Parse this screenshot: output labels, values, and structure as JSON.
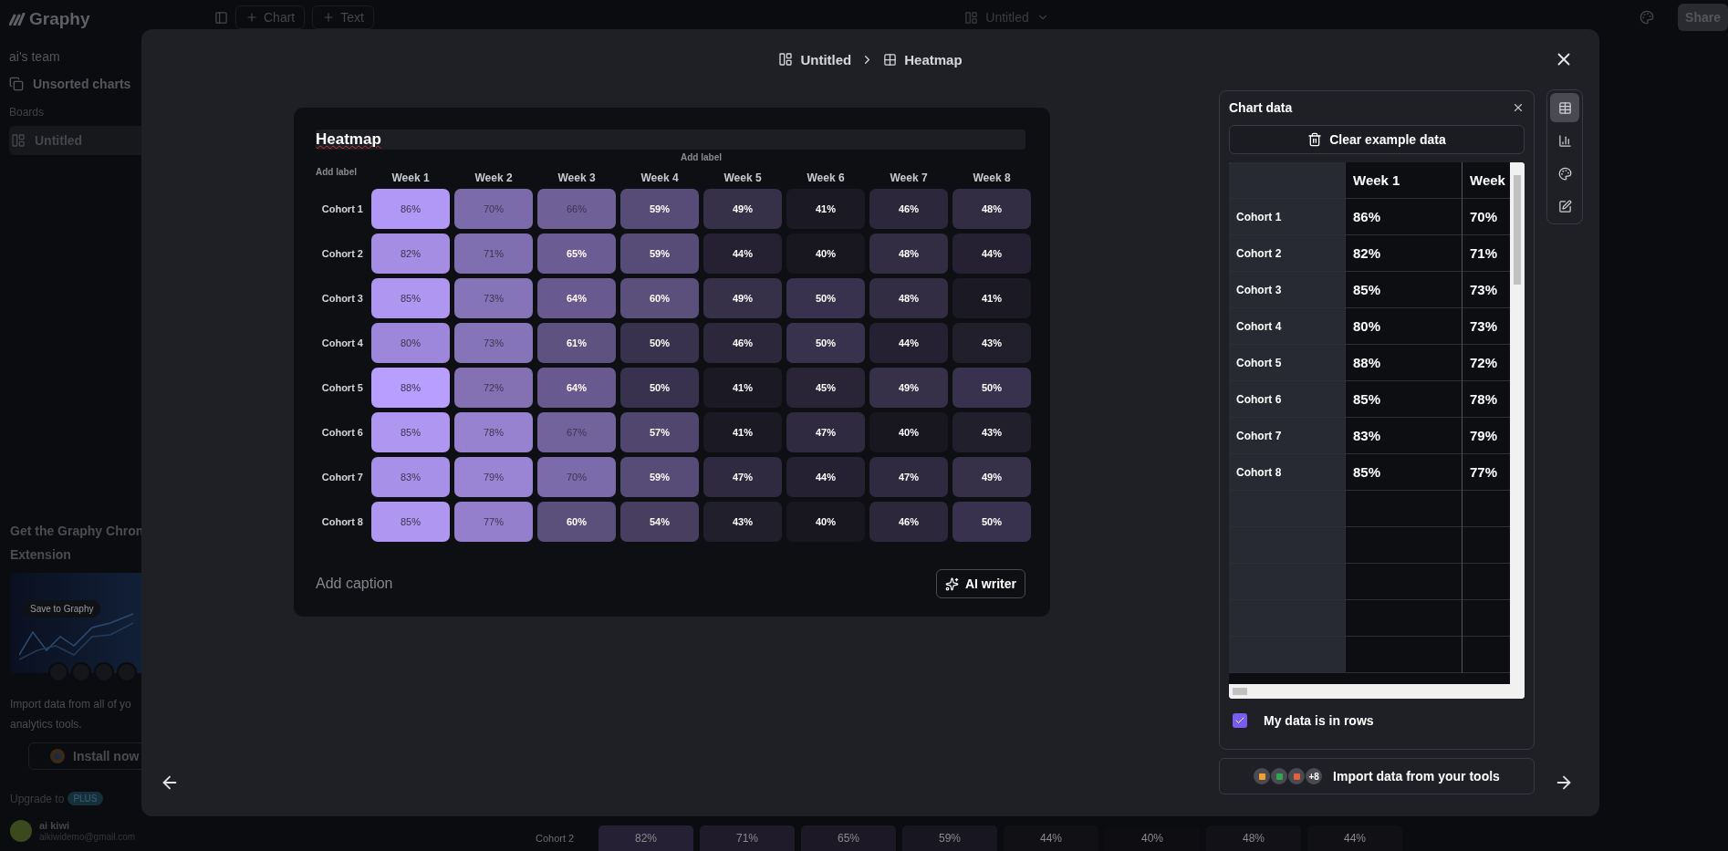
{
  "app": {
    "logo": "Graphy",
    "team": "ai's team",
    "nav": [
      {
        "label": "Unsorted charts"
      }
    ],
    "boards_heading": "Boards",
    "boards": [
      {
        "label": "Untitled",
        "selected": true
      }
    ],
    "promo": {
      "title_lines": [
        "Get the Graphy Chron",
        "Extension"
      ],
      "image_button": "Save to Graphy",
      "text_lines": [
        "Import data from all of yo",
        "analytics tools."
      ],
      "install_button": "Install now"
    },
    "upgrade": {
      "label": "Upgrade to",
      "badge": "PLUS"
    },
    "user": {
      "name": "ai kiwi",
      "email": "aikiwidemo@gmail.com"
    },
    "toolbar": {
      "buttons": [
        "Chart",
        "Text"
      ],
      "board_title": "Untitled",
      "share": "Share"
    },
    "background_row": {
      "label": "Cohort 2",
      "values": [
        "82%",
        "71%",
        "65%",
        "59%",
        "44%",
        "40%",
        "48%",
        "44%"
      ]
    }
  },
  "modal": {
    "breadcrumb": {
      "board": "Untitled",
      "chart": "Heatmap"
    },
    "chart": {
      "title": "Heatmap",
      "x_label_placeholder": "Add label",
      "y_label_placeholder": "Add label",
      "columns": [
        "Week 1",
        "Week 2",
        "Week 3",
        "Week 4",
        "Week 5",
        "Week 6",
        "Week 7",
        "Week 8"
      ],
      "rows": [
        {
          "label": "Cohort 1",
          "values": [
            "86%",
            "70%",
            "66%",
            "59%",
            "49%",
            "41%",
            "46%",
            "48%"
          ]
        },
        {
          "label": "Cohort 2",
          "values": [
            "82%",
            "71%",
            "65%",
            "59%",
            "44%",
            "40%",
            "48%",
            "44%"
          ]
        },
        {
          "label": "Cohort 3",
          "values": [
            "85%",
            "73%",
            "64%",
            "60%",
            "49%",
            "50%",
            "48%",
            "41%"
          ]
        },
        {
          "label": "Cohort 4",
          "values": [
            "80%",
            "73%",
            "61%",
            "50%",
            "46%",
            "50%",
            "44%",
            "43%"
          ]
        },
        {
          "label": "Cohort 5",
          "values": [
            "88%",
            "72%",
            "64%",
            "50%",
            "41%",
            "45%",
            "49%",
            "50%"
          ]
        },
        {
          "label": "Cohort 6",
          "values": [
            "85%",
            "78%",
            "67%",
            "57%",
            "41%",
            "47%",
            "40%",
            "43%"
          ]
        },
        {
          "label": "Cohort 7",
          "values": [
            "83%",
            "79%",
            "70%",
            "59%",
            "47%",
            "44%",
            "47%",
            "49%"
          ]
        },
        {
          "label": "Cohort 8",
          "values": [
            "85%",
            "77%",
            "60%",
            "54%",
            "43%",
            "40%",
            "46%",
            "50%"
          ]
        }
      ],
      "caption_placeholder": "Add caption",
      "ai_button": "AI writer"
    },
    "data_panel": {
      "title": "Chart data",
      "clear_button": "Clear example data",
      "columns": [
        "Week 1",
        "Week"
      ],
      "rows": [
        {
          "label": "Cohort 1",
          "values": [
            "86%",
            "70%"
          ]
        },
        {
          "label": "Cohort 2",
          "values": [
            "82%",
            "71%"
          ]
        },
        {
          "label": "Cohort 3",
          "values": [
            "85%",
            "73%"
          ]
        },
        {
          "label": "Cohort 4",
          "values": [
            "80%",
            "73%"
          ]
        },
        {
          "label": "Cohort 5",
          "values": [
            "88%",
            "72%"
          ]
        },
        {
          "label": "Cohort 6",
          "values": [
            "85%",
            "78%"
          ]
        },
        {
          "label": "Cohort 7",
          "values": [
            "83%",
            "79%"
          ]
        },
        {
          "label": "Cohort 8",
          "values": [
            "85%",
            "77%"
          ]
        }
      ],
      "rows_checkbox": {
        "label": "My data is in rows",
        "checked": true
      }
    },
    "tools": [
      {
        "kind": "table",
        "selected": true
      },
      {
        "kind": "chart",
        "selected": false
      },
      {
        "kind": "palette",
        "selected": false
      },
      {
        "kind": "edit",
        "selected": false
      }
    ],
    "import_button": {
      "label": "Import data from your tools",
      "more": "+8"
    }
  }
}
